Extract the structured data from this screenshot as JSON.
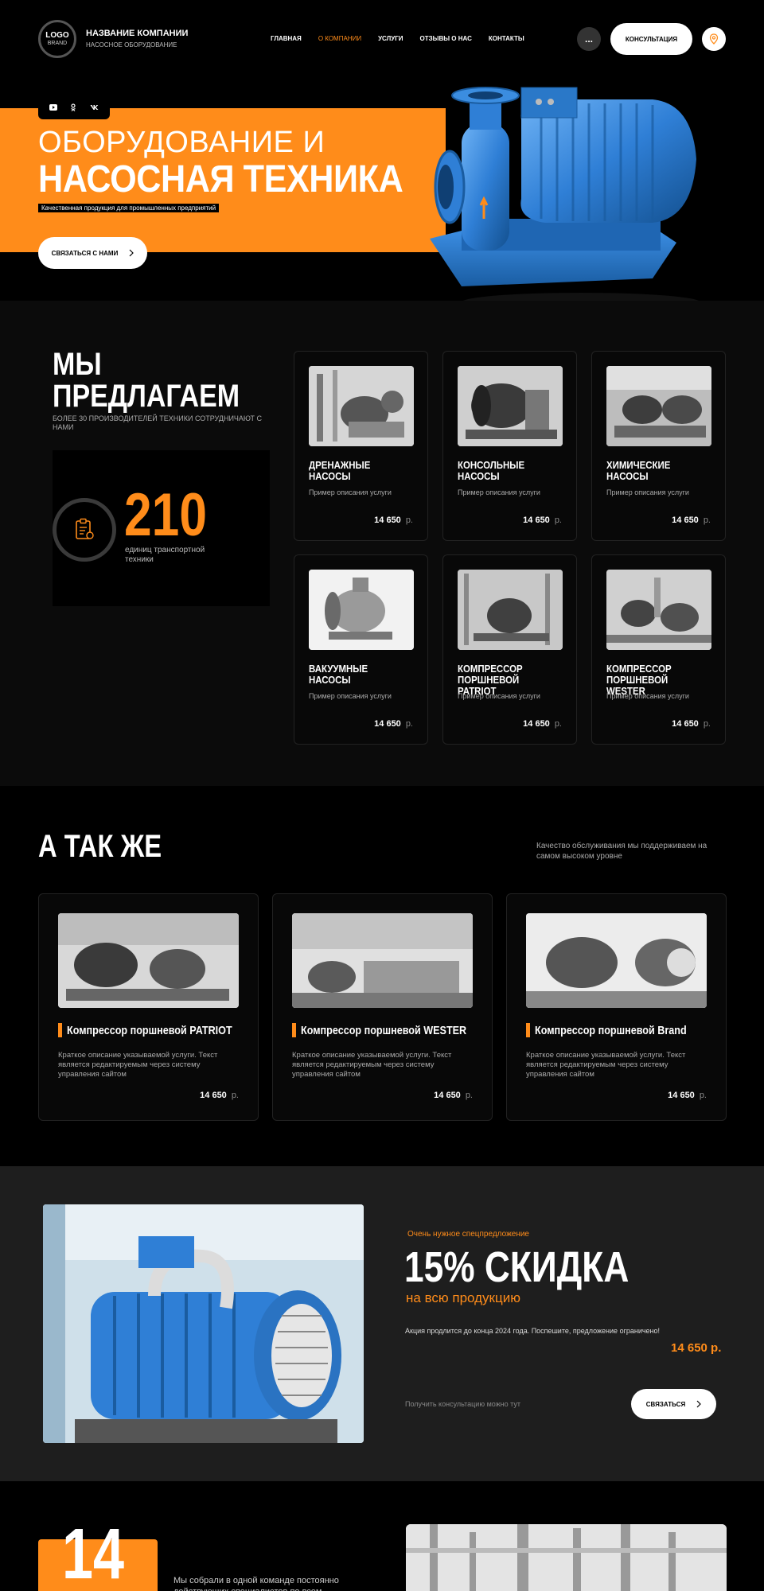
{
  "header": {
    "logo_line1": "LOGO",
    "logo_line2": "BRAND",
    "company_name": "НАЗВАНИЕ КОМПАНИИ",
    "company_sub": "НАСОСНОЕ ОБОРУДОВАНИЕ",
    "nav": [
      "ГЛАВНАЯ",
      "О КОМПАНИИ",
      "УСЛУГИ",
      "ОТЗЫВЫ О НАС",
      "КОНТАКТЫ"
    ],
    "nav_active_index": 1,
    "more_label": "...",
    "consult_label": "КОНСУЛЬТАЦИЯ",
    "location_icon": "map-pin-icon"
  },
  "hero": {
    "social": [
      "youtube-icon",
      "odnoklassniki-icon",
      "vk-icon"
    ],
    "title_line1": "ОБОРУДОВАНИЕ И",
    "title_line2": "НАСОСНАЯ ТЕХНИКА",
    "tagline": "Качественная продукция для промышленных предприятий",
    "cta_label": "СВЯЗАТЬСЯ С НАМИ"
  },
  "offers": {
    "title_line1": "МЫ",
    "title_line2": "ПРЕДЛАГАЕМ",
    "subtitle": "БОЛЕЕ 30 ПРОИЗВОДИТЕЛЕЙ ТЕХНИКИ СОТРУДНИЧАЮТ С НАМИ",
    "stat_value": "210",
    "stat_label": "единиц транспортной техники",
    "cards": [
      {
        "title": "ДРЕНАЖНЫЕ НАСОСЫ",
        "desc": "Пример описания услуги",
        "price": "14 650",
        "currency": "р."
      },
      {
        "title": "КОНСОЛЬНЫЕ НАСОСЫ",
        "desc": "Пример описания услуги",
        "price": "14 650",
        "currency": "р."
      },
      {
        "title": "ХИМИЧЕСКИЕ НАСОСЫ",
        "desc": "Пример описания услуги",
        "price": "14 650",
        "currency": "р."
      },
      {
        "title": "ВАКУУМНЫЕ НАСОСЫ",
        "desc": "Пример описания услуги",
        "price": "14 650",
        "currency": "р."
      },
      {
        "title": "КОМПРЕССОР ПОРШНЕВОЙ PATRIOT",
        "desc": "Пример описания услуги",
        "price": "14 650",
        "currency": "р."
      },
      {
        "title": "КОМПРЕССОР ПОРШНЕВОЙ WESTER",
        "desc": "Пример описания услуги",
        "price": "14 650",
        "currency": "р."
      }
    ]
  },
  "also": {
    "title": "А ТАК ЖЕ",
    "note": "Качество обслуживания мы поддерживаем на самом высоком уровне",
    "cards": [
      {
        "title": "Компрессор поршневой PATRIOT",
        "desc": "Краткое описание указываемой услуги. Текст является редактируемым через систему управления сайтом",
        "price": "14 650",
        "currency": "р."
      },
      {
        "title": "Компрессор поршневой WESTER",
        "desc": "Краткое описание указываемой услуги. Текст является редактируемым через систему управления сайтом",
        "price": "14 650",
        "currency": "р."
      },
      {
        "title": "Компрессор поршневой Brand",
        "desc": "Краткое описание указываемой услуги. Текст является редактируемым через систему управления сайтом",
        "price": "14 650",
        "currency": "р."
      }
    ]
  },
  "promo": {
    "kicker": "Очень нужное спецпредложение",
    "title": "15% СКИДКА",
    "subtitle": "на всю продукцию",
    "note": "Акция продлится до конца 2024 года. Поспешите, предложение ограничено!",
    "price": "14 650 р.",
    "cta_note": "Получить консультацию можно тут",
    "cta_label": "СВЯЗАТЬСЯ"
  },
  "team": {
    "number": "14",
    "text": "Мы собрали в одной команде постоянно действующих специалистов по всем"
  },
  "colors": {
    "accent": "#ff8c1a",
    "background": "#000000",
    "section_dark": "#0b0b0b",
    "promo_bg": "#1e1e1e",
    "pump_blue": "#2f7fd6"
  }
}
